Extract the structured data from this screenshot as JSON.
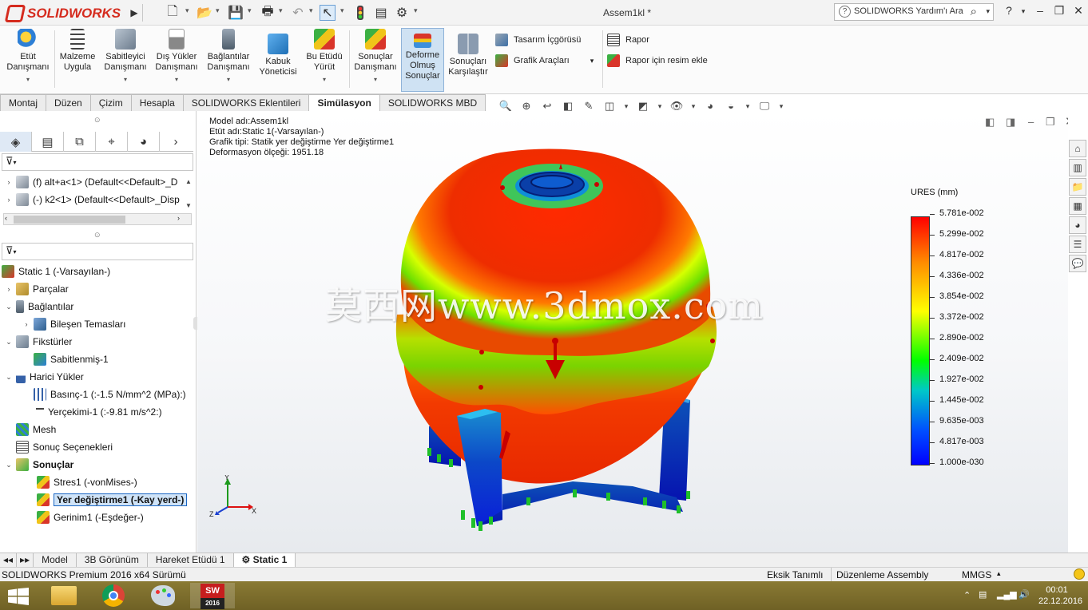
{
  "app": {
    "name": "SOLIDWORKS",
    "doc_title": "Assem1kl *"
  },
  "search": {
    "placeholder": "SOLIDWORKS Yardım'ı Ara",
    "help": "?"
  },
  "ribbon": {
    "buttons": [
      {
        "label1": "Etüt",
        "label2": "Danışmanı",
        "label3": ""
      },
      {
        "label1": "Malzeme",
        "label2": "Uygula",
        "label3": ""
      },
      {
        "label1": "Sabitleyici",
        "label2": "Danışmanı",
        "label3": ""
      },
      {
        "label1": "Dış Yükler",
        "label2": "Danışmanı",
        "label3": ""
      },
      {
        "label1": "Bağlantılar",
        "label2": "Danışmanı",
        "label3": ""
      },
      {
        "label1": "Kabuk",
        "label2": "Yöneticisi",
        "label3": ""
      },
      {
        "label1": "Bu Etüdü",
        "label2": "Yürüt",
        "label3": ""
      },
      {
        "label1": "Sonuçlar",
        "label2": "Danışmanı",
        "label3": ""
      },
      {
        "label1": "Deforme",
        "label2": "Olmuş",
        "label3": "Sonuçlar"
      },
      {
        "label1": "Sonuçları",
        "label2": "Karşılaştır",
        "label3": ""
      }
    ],
    "small": [
      "Tasarım İçgörüsü",
      "Grafik Araçları",
      "Rapor",
      "Rapor için resim ekle"
    ]
  },
  "tabs": [
    "Montaj",
    "Düzen",
    "Çizim",
    "Hesapla",
    "SOLIDWORKS Eklentileri",
    "Simülasyon",
    "SOLIDWORKS MBD"
  ],
  "tree_top": [
    {
      "label": "(f) alt+a<1> (Default<<Default>_D"
    },
    {
      "label": "(-) k2<1> (Default<<Default>_Disp"
    }
  ],
  "tree": [
    {
      "label": "Static 1 (-Varsayılan-)",
      "bold": false
    },
    {
      "label": "Parçalar"
    },
    {
      "label": "Bağlantılar"
    },
    {
      "label": "Bileşen Temasları"
    },
    {
      "label": "Fikstürler"
    },
    {
      "label": "Sabitlenmiş-1"
    },
    {
      "label": "Harici Yükler"
    },
    {
      "label": "Basınç-1 (:-1.5 N/mm^2 (MPa):)"
    },
    {
      "label": "Yerçekimi-1 (:-9.81 m/s^2:)"
    },
    {
      "label": "Mesh"
    },
    {
      "label": "Sonuç Seçenekleri"
    },
    {
      "label": "Sonuçlar"
    },
    {
      "label": "Stres1 (-vonMises-)"
    },
    {
      "label": "Yer değiştirme1 (-Kay yerd-)"
    },
    {
      "label": "Gerinim1 (-Eşdeğer-)"
    }
  ],
  "viewport": {
    "meta": [
      "Model adı:Assem1kl",
      "Etüt adı:Static 1(-Varsayılan-)",
      "Grafik tipi: Statik yer değiştirme Yer değiştirme1",
      "Deformasyon ölçeği: 1951.18"
    ],
    "watermark": "莫西网www.3dmox.com",
    "triad": {
      "x": "X",
      "y": "Y",
      "z": "Z"
    }
  },
  "legend": {
    "title": "URES (mm)",
    "labels": [
      "5.781e-002",
      "5.299e-002",
      "4.817e-002",
      "4.336e-002",
      "3.854e-002",
      "3.372e-002",
      "2.890e-002",
      "2.409e-002",
      "1.927e-002",
      "1.445e-002",
      "9.635e-003",
      "4.817e-003",
      "1.000e-030"
    ],
    "colors": {
      "max": "#ff0000",
      "mid": "#00ff00",
      "min": "#0000ff"
    }
  },
  "bottom_tabs": [
    "Model",
    "3B Görünüm",
    "Hareket Etüdü 1",
    "Static 1"
  ],
  "status": {
    "left": "SOLIDWORKS Premium 2016 x64 Sürümü",
    "s1": "Eksik Tanımlı",
    "s2": "Düzenleme Assembly",
    "s3": "MMGS"
  },
  "taskbar": {
    "time": "00:01",
    "date": "22.12.2016",
    "sw_badge": "2016"
  }
}
